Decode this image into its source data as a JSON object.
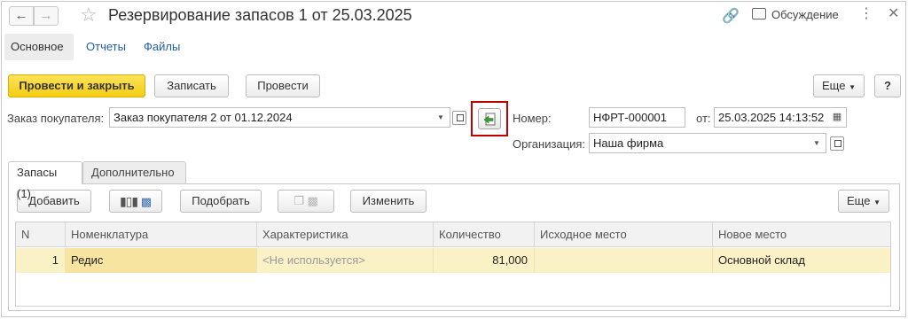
{
  "window": {
    "title": "Резервирование запасов 1 от 25.03.2025",
    "discussion_label": "Обсуждение"
  },
  "section_tabs": [
    {
      "label": "Основное",
      "active": true
    },
    {
      "label": "Отчеты",
      "active": false
    },
    {
      "label": "Файлы",
      "active": false
    }
  ],
  "toolbar": {
    "post_and_close": "Провести и закрыть",
    "save": "Записать",
    "post": "Провести",
    "more": "Еще",
    "help": "?"
  },
  "form": {
    "customer_order_label": "Заказ покупателя:",
    "customer_order_value": "Заказ покупателя 2 от 01.12.2024",
    "number_label": "Номер:",
    "number_value": "НФРТ-000001",
    "date_label": "от:",
    "date_value": "25.03.2025 14:13:52",
    "organization_label": "Организация:",
    "organization_value": "Наша фирма"
  },
  "tabs": [
    {
      "label": "Запасы (1)",
      "active": true
    },
    {
      "label": "Дополнительно",
      "active": false
    }
  ],
  "table_toolbar": {
    "add": "Добавить",
    "pick": "Подобрать",
    "change": "Изменить",
    "more": "Еще"
  },
  "table": {
    "columns": [
      "N",
      "Номенклатура",
      "Характеристика",
      "Количество",
      "Исходное место",
      "Новое место"
    ],
    "rows": [
      {
        "n": "1",
        "item": "Редис",
        "characteristic": "<Не используется>",
        "quantity": "81,000",
        "source": "",
        "destination": "Основной склад"
      }
    ]
  },
  "colors": {
    "primary_button": "#f5cd10",
    "link": "#1f5ea8",
    "row_highlight": "#fbf1c7",
    "callout_border": "#c00000"
  }
}
